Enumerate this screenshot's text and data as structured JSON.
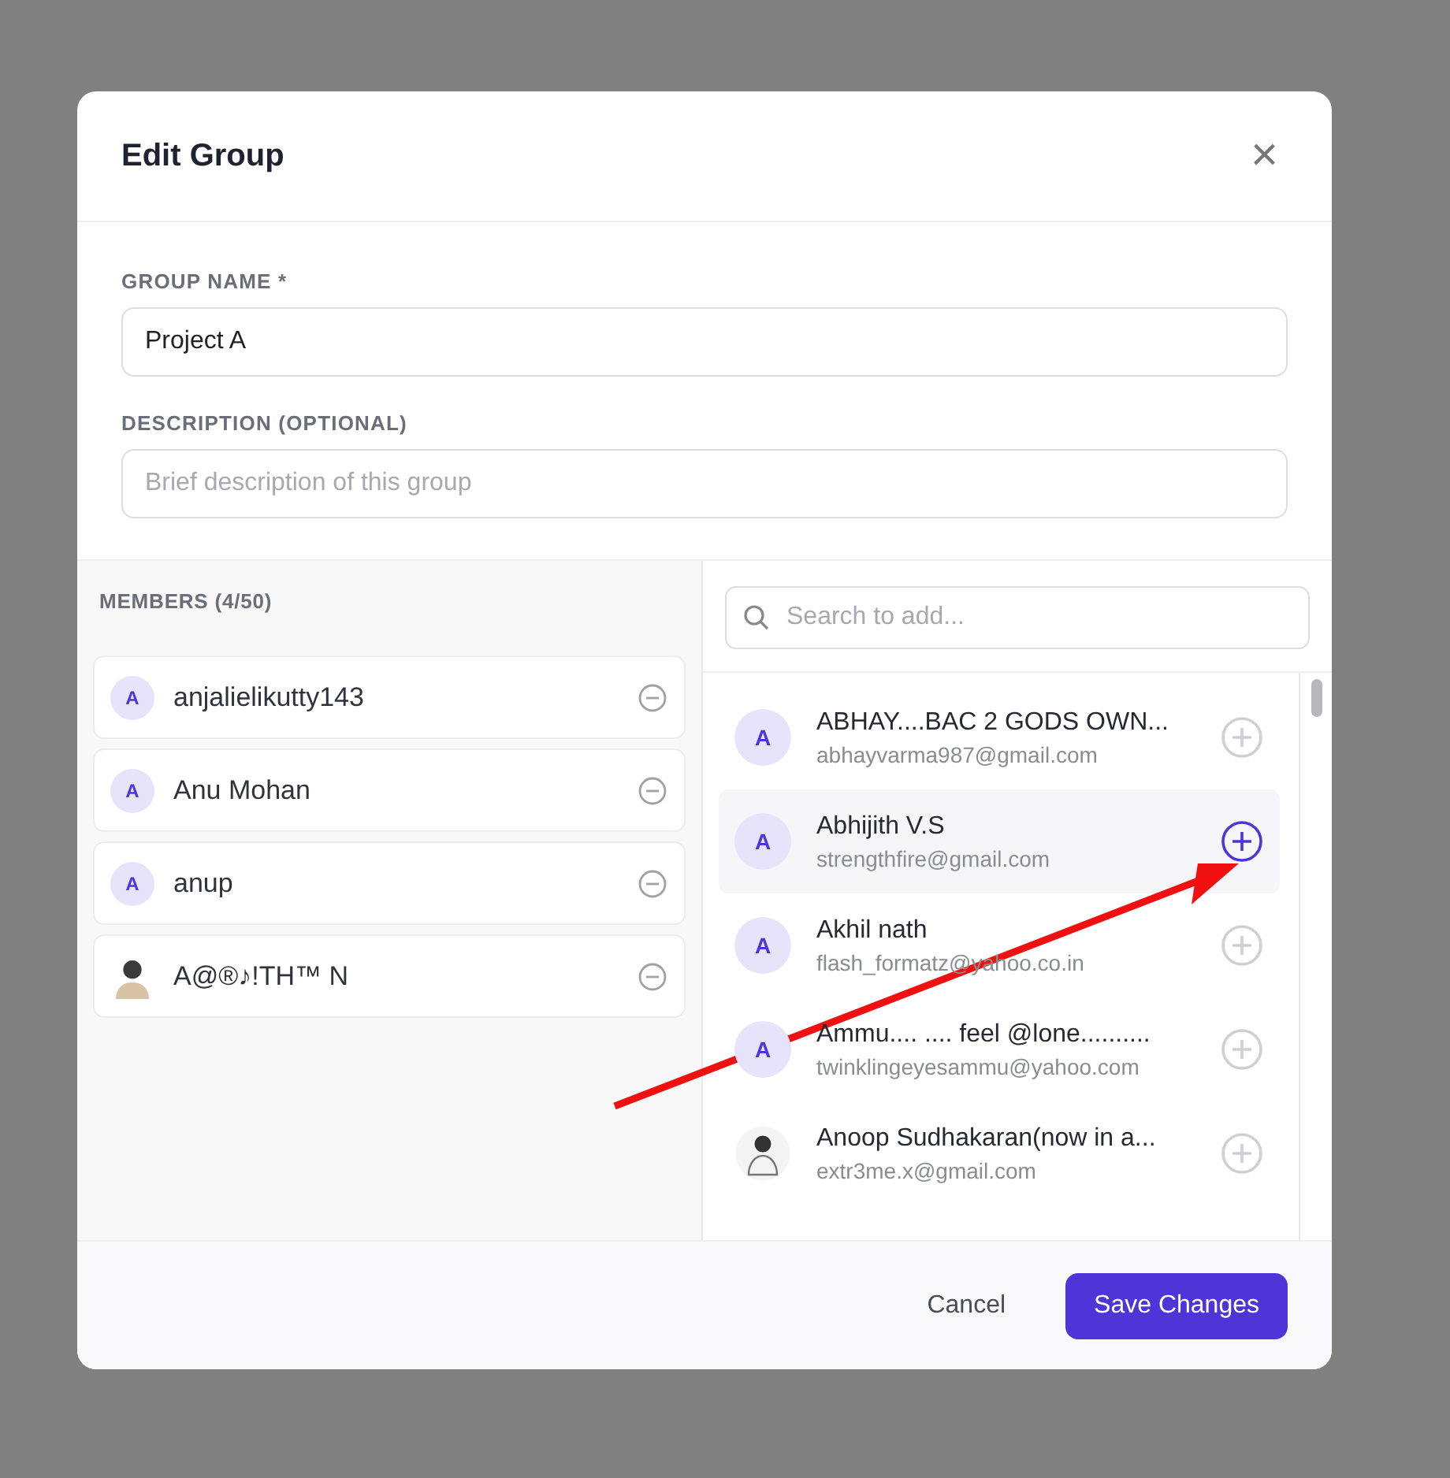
{
  "dialog": {
    "title": "Edit Group",
    "close": "×"
  },
  "fields": [
    {
      "label": "GROUP NAME *",
      "value": "Project A"
    },
    {
      "label": "DESCRIPTION (OPTIONAL)",
      "placeholder": "Brief description of this group"
    }
  ],
  "members": {
    "heading": "MEMBERS (4/50)",
    "items": [
      {
        "kind": "initial",
        "initial": "A",
        "name": "anjalielikutty143"
      },
      {
        "kind": "initial",
        "initial": "A",
        "name": "Anu Mohan"
      },
      {
        "kind": "initial",
        "initial": "A",
        "name": "anup"
      },
      {
        "kind": "photo",
        "name": "A@®♪!TH™ N"
      }
    ]
  },
  "search": {
    "placeholder": "Search to add..."
  },
  "candidates": [
    {
      "kind": "initial",
      "initial": "A",
      "name": "ABHAY....BAC 2 GODS OWN...",
      "email": "abhayvarma987@gmail.com",
      "hovered": false
    },
    {
      "kind": "initial",
      "initial": "A",
      "name": "Abhijith V.S",
      "email": "strengthfire@gmail.com",
      "hovered": true
    },
    {
      "kind": "initial",
      "initial": "A",
      "name": "Akhil nath",
      "email": "flash_formatz@yahoo.co.in",
      "hovered": false
    },
    {
      "kind": "initial",
      "initial": "A",
      "name": "Ammu.... .... feel @lone..........",
      "email": "twinklingeyesammu@yahoo.com",
      "hovered": false
    },
    {
      "kind": "photo",
      "name": "Anoop Sudhakaran(now in a...",
      "email": "extr3me.x@gmail.com",
      "hovered": false
    }
  ],
  "buttons": [
    {
      "label": "Cancel",
      "kind": "secondary"
    },
    {
      "label": "Save Changes",
      "kind": "primary"
    }
  ]
}
